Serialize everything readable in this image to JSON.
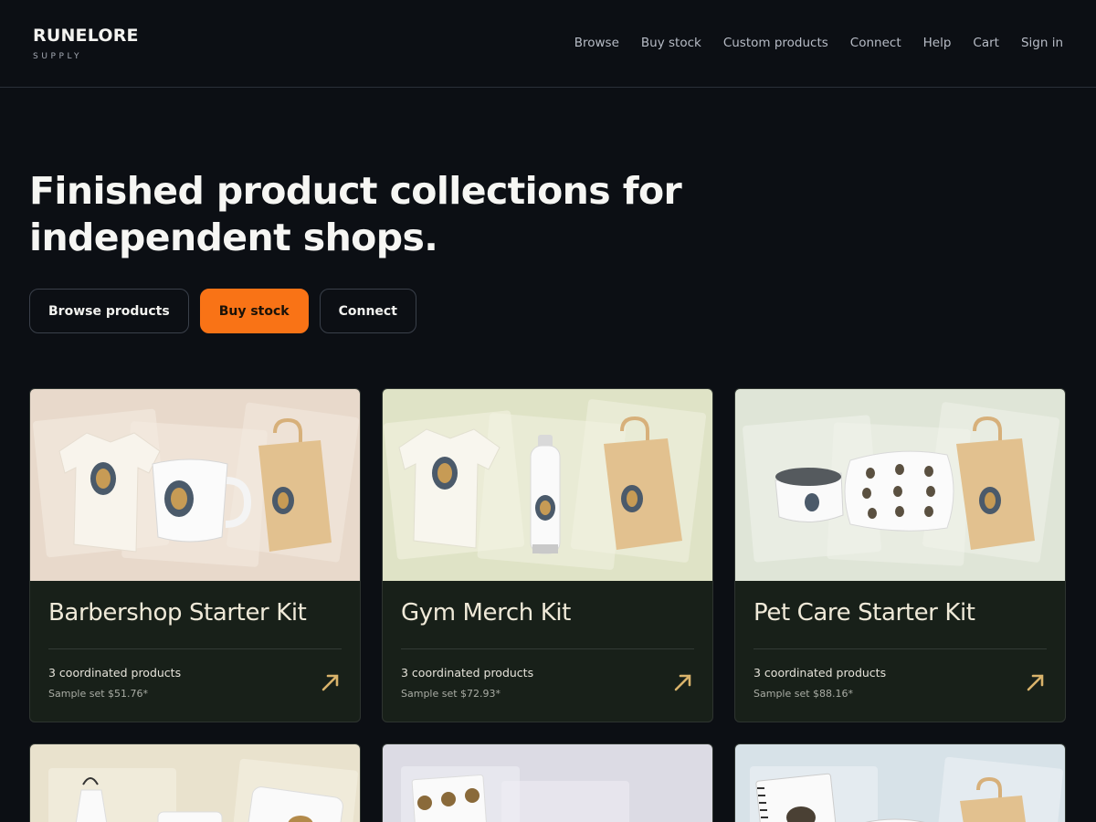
{
  "brand": {
    "name": "RUNELORE",
    "tagline": "SUPPLY"
  },
  "nav": {
    "items": [
      {
        "label": "Browse"
      },
      {
        "label": "Buy stock"
      },
      {
        "label": "Custom products"
      },
      {
        "label": "Connect"
      },
      {
        "label": "Help"
      },
      {
        "label": "Cart"
      },
      {
        "label": "Sign in"
      }
    ]
  },
  "hero": {
    "title_line1": "Finished product collections for",
    "title_line2": "independent shops.",
    "buttons": {
      "browse": "Browse products",
      "buy": "Buy stock",
      "connect": "Connect"
    }
  },
  "colors": {
    "accent": "#f97316",
    "background": "#0c0f14",
    "card_body": "#182019",
    "card_title": "#efe9d8",
    "arrow": "#d9b36b"
  },
  "cards": [
    {
      "title": "Barbershop Starter Kit",
      "count": "3 coordinated products",
      "price": "Sample set $51.76*",
      "bg": "#e8d9cb",
      "icon": "arrow-up-right-icon"
    },
    {
      "title": "Gym Merch Kit",
      "count": "3 coordinated products",
      "price": "Sample set $72.93*",
      "bg": "#dfe3c6",
      "icon": "arrow-up-right-icon"
    },
    {
      "title": "Pet Care Starter Kit",
      "count": "3 coordinated products",
      "price": "Sample set $88.16*",
      "bg": "#dfe5d7",
      "icon": "arrow-up-right-icon"
    },
    {
      "bg": "#e9e2cd"
    },
    {
      "bg": "#dcdbe4"
    },
    {
      "bg": "#d7e2e8"
    }
  ]
}
